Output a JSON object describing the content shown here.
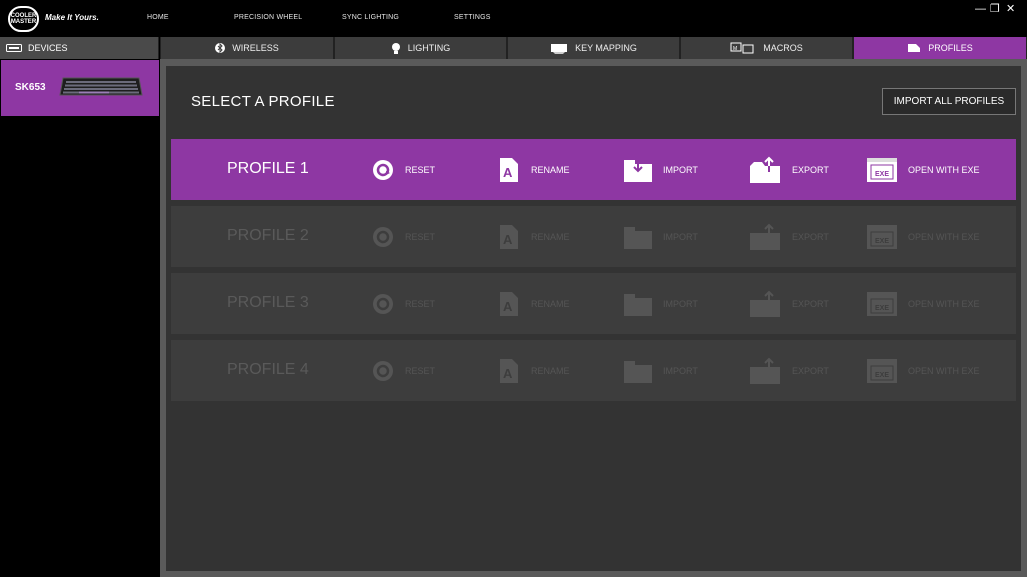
{
  "brand": {
    "logo_text": "COOLER MASTER",
    "tagline": "Make It Yours."
  },
  "topnav": [
    "HOME",
    "PRECISION WHEEL",
    "SYNC LIGHTING",
    "SETTINGS"
  ],
  "window_controls": {
    "minimize": "—",
    "restore": "❐",
    "close": "✕"
  },
  "devices_tab": {
    "label": "DEVICES",
    "icon": "keyboard-icon"
  },
  "tabs": [
    {
      "label": "WIRELESS",
      "icon": "bluetooth-icon"
    },
    {
      "label": "LIGHTING",
      "icon": "bulb-icon"
    },
    {
      "label": "KEY MAPPING",
      "icon": "key-icon"
    },
    {
      "label": "MACROS",
      "icon": "macro-icon"
    },
    {
      "label": "PROFILES",
      "icon": "profile-icon",
      "active": true
    }
  ],
  "device": {
    "name": "SK653"
  },
  "main": {
    "title": "SELECT A PROFILE",
    "import_all": "IMPORT ALL PROFILES"
  },
  "profile_actions": [
    "RESET",
    "RENAME",
    "IMPORT",
    "EXPORT",
    "OPEN WITH EXE"
  ],
  "exe_label": "EXE",
  "profiles": [
    {
      "name": "PROFILE 1",
      "active": true
    },
    {
      "name": "PROFILE 2",
      "active": false
    },
    {
      "name": "PROFILE 3",
      "active": false
    },
    {
      "name": "PROFILE 4",
      "active": false
    }
  ],
  "colors": {
    "accent": "#8e37a3",
    "panel": "#333333",
    "inactive_row": "#3d3d3d"
  }
}
